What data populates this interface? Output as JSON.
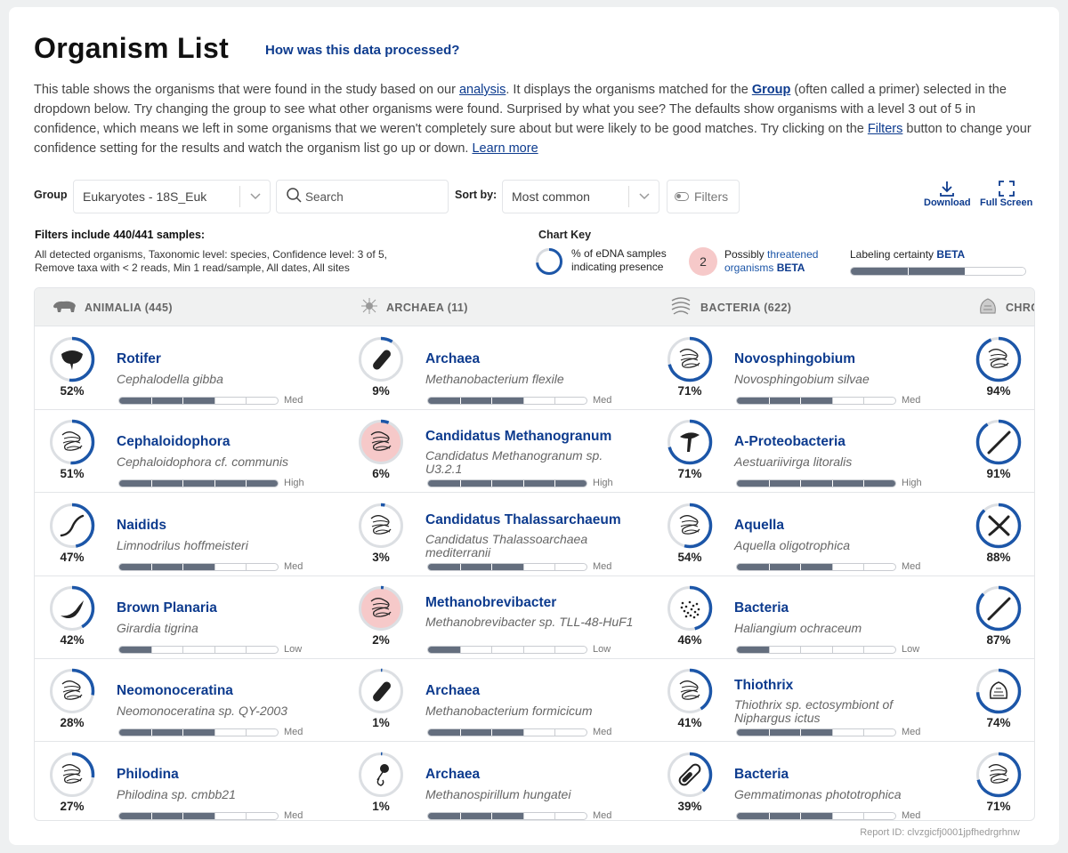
{
  "header": {
    "title": "Organism List",
    "help_link": "How was this data processed?"
  },
  "intro": {
    "p1": "This table shows the organisms that were found in the study based on our ",
    "analysis_link": "analysis",
    "p2": ". It displays the organisms matched for the ",
    "group_link": "Group",
    "p3": " (often called a primer) selected in the dropdown below. Try changing the group to see what other organisms were found. Surprised by what you see? The defaults show organisms with a level 3 out of 5 in confidence, which means we left in some organisms that we weren't completely sure about but were likely to be good matches. Try clicking on the ",
    "filters_link": "Filters",
    "p4": " button to change your confidence setting for the results and watch the organism list go up or down. ",
    "learn_more": "Learn more"
  },
  "controls": {
    "group_label": "Group",
    "group_value": "Eukaryotes - 18S_Euk",
    "search_placeholder": "Search",
    "sort_label": "Sort by:",
    "sort_value": "Most common",
    "filters_label": "Filters",
    "download_label": "Download",
    "fullscreen_label": "Full Screen"
  },
  "filters_summary": {
    "heading": "Filters include 440/441 samples:",
    "description": "All detected organisms, Taxonomic level: species, Confidence level: 3 of 5, Remove taxa with < 2 reads, Min 1 read/sample,  All dates, All sites"
  },
  "chart_key": {
    "title": "Chart Key",
    "edna_text": "% of eDNA samples indicating presence",
    "threat_count": "2",
    "threat_prefix": "Possibly ",
    "threat_link": "threatened",
    "threat_suffix": " organisms ",
    "beta": "BETA",
    "cert_label": "Labeling certainty "
  },
  "columns": [
    {
      "label": "ANIMALIA (445)",
      "icon": "capybara-icon"
    },
    {
      "label": "ARCHAEA (11)",
      "icon": "archaea-icon"
    },
    {
      "label": "BACTERIA (622)",
      "icon": "bacteria-icon"
    },
    {
      "label": "CHROMISTA",
      "icon": "chromista-icon"
    }
  ],
  "colors": {
    "brand_blue": "#0d3b8e",
    "ring_blue": "#1c56a8",
    "threat_pink": "#f6c9c9",
    "bar_gray": "#646e7e"
  },
  "rows": [
    [
      {
        "name": "Rotifer",
        "sci": "Cephalodella gibba",
        "pct": "52%",
        "pv": 0.52,
        "conf": "Med",
        "cv": 0.6,
        "icon": "rotifer-icon",
        "threat": false
      },
      {
        "name": "Archaea",
        "sci": "Methanobacterium flexile",
        "pct": "9%",
        "pv": 0.09,
        "conf": "Med",
        "cv": 0.6,
        "icon": "rod-icon",
        "threat": false
      },
      {
        "name": "Novosphingobium",
        "sci": "Novosphingobium silvae",
        "pct": "71%",
        "pv": 0.71,
        "conf": "Med",
        "cv": 0.6,
        "icon": "squiggle-icon",
        "threat": false
      },
      {
        "pct": "94%",
        "pv": 0.94,
        "icon": "squiggle-icon",
        "threat": false
      }
    ],
    [
      {
        "name": "Cephaloidophora",
        "sci": "Cephaloidophora cf. communis",
        "pct": "51%",
        "pv": 0.51,
        "conf": "High",
        "cv": 1.0,
        "icon": "squiggle-icon",
        "threat": false
      },
      {
        "name": "Candidatus Methanogranum",
        "sci": "Candidatus Methanogranum sp. U3.2.1",
        "pct": "6%",
        "pv": 0.06,
        "conf": "High",
        "cv": 1.0,
        "icon": "squiggle-icon",
        "threat": true
      },
      {
        "name": "A-Proteobacteria",
        "sci": "Aestuariivirga litoralis",
        "pct": "71%",
        "pv": 0.71,
        "conf": "High",
        "cv": 1.0,
        "icon": "mushroom-icon",
        "threat": false
      },
      {
        "pct": "91%",
        "pv": 0.91,
        "icon": "diagonal-rod-icon",
        "threat": false
      }
    ],
    [
      {
        "name": "Naidids",
        "sci": "Limnodrilus hoffmeisteri",
        "pct": "47%",
        "pv": 0.47,
        "conf": "Med",
        "cv": 0.6,
        "icon": "worm-icon",
        "threat": false
      },
      {
        "name": "Candidatus Thalassarchaeum",
        "sci": "Candidatus Thalassoarchaea mediterranii",
        "pct": "3%",
        "pv": 0.03,
        "conf": "Med",
        "cv": 0.6,
        "icon": "squiggle-icon",
        "threat": false
      },
      {
        "name": "Aquella",
        "sci": "Aquella oligotrophica",
        "pct": "54%",
        "pv": 0.54,
        "conf": "Med",
        "cv": 0.6,
        "icon": "squiggle-icon",
        "threat": false
      },
      {
        "pct": "88%",
        "pv": 0.88,
        "icon": "cross-icon",
        "threat": false
      }
    ],
    [
      {
        "name": "Brown Planaria",
        "sci": "Girardia tigrina",
        "pct": "42%",
        "pv": 0.42,
        "conf": "Low",
        "cv": 0.2,
        "icon": "planaria-icon",
        "threat": false
      },
      {
        "name": "Methanobrevibacter",
        "sci": "Methanobrevibacter sp. TLL-48-HuF1",
        "pct": "2%",
        "pv": 0.02,
        "conf": "Low",
        "cv": 0.2,
        "icon": "squiggle-icon",
        "threat": true
      },
      {
        "name": "Bacteria",
        "sci": "Haliangium ochraceum",
        "pct": "46%",
        "pv": 0.46,
        "conf": "Low",
        "cv": 0.2,
        "icon": "dots-icon",
        "threat": false
      },
      {
        "pct": "87%",
        "pv": 0.87,
        "icon": "diagonal-rod-icon",
        "threat": false
      }
    ],
    [
      {
        "name": "Neomonoceratina",
        "sci": "Neomonoceratina sp. QY-2003",
        "pct": "28%",
        "pv": 0.28,
        "conf": "Med",
        "cv": 0.6,
        "icon": "squiggle-icon",
        "threat": false
      },
      {
        "name": "Archaea",
        "sci": "Methanobacterium formicicum",
        "pct": "1%",
        "pv": 0.01,
        "conf": "Med",
        "cv": 0.6,
        "icon": "rod-icon",
        "threat": false
      },
      {
        "name": "Thiothrix",
        "sci": "Thiothrix sp. ectosymbiont of Niphargus ictus",
        "pct": "41%",
        "pv": 0.41,
        "conf": "Med",
        "cv": 0.6,
        "icon": "squiggle-icon",
        "threat": false
      },
      {
        "pct": "74%",
        "pv": 0.74,
        "icon": "diatom-icon",
        "threat": false
      }
    ],
    [
      {
        "name": "Philodina",
        "sci": "Philodina sp. cmbb21",
        "pct": "27%",
        "pv": 0.27,
        "conf": "Med",
        "cv": 0.6,
        "icon": "squiggle-icon",
        "threat": false
      },
      {
        "name": "Archaea",
        "sci": "Methanospirillum hungatei",
        "pct": "1%",
        "pv": 0.01,
        "conf": "Med",
        "cv": 0.6,
        "icon": "flagellate-icon",
        "threat": false
      },
      {
        "name": "Bacteria",
        "sci": "Gemmatimonas phototrophica",
        "pct": "39%",
        "pv": 0.39,
        "conf": "Med",
        "cv": 0.6,
        "icon": "capsule-icon",
        "threat": false
      },
      {
        "pct": "71%",
        "pv": 0.71,
        "icon": "squiggle-icon",
        "threat": false
      }
    ]
  ],
  "report_id": "Report ID: clvzgicfj0001jpfhedrgrhnw"
}
